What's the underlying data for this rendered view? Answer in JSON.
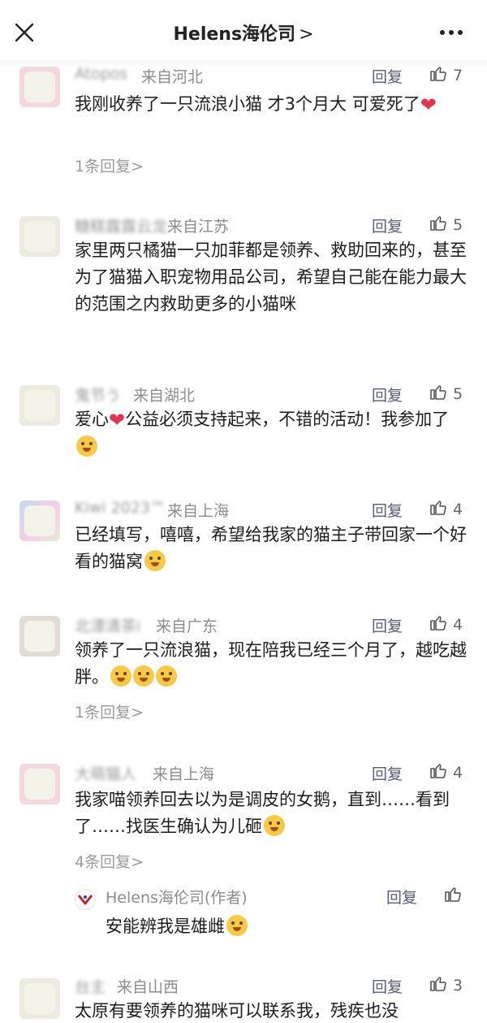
{
  "header": {
    "title": "Helens海伦司",
    "title_arrow": ">",
    "close_icon": "close-icon",
    "more_icon": "more-dots-icon"
  },
  "comments": [
    {
      "user": "Atopos",
      "location": "来自河北",
      "reply_label": "回复",
      "likes": "7",
      "text": "我刚收养了一只流浪小猫 才3个月大 可爱死了",
      "more_replies": "1条回复>"
    },
    {
      "user": "糖糕露露云龙",
      "location": "来自江苏",
      "reply_label": "回复",
      "likes": "5",
      "text": "家里两只橘猫一只加菲都是领养、救助回来的，甚至为了猫猫入职宠物用品公司，希望自己能在能力最大的范围之内救助更多的小猫咪"
    },
    {
      "user": "鬼节う",
      "location": "来自湖北",
      "reply_label": "回复",
      "likes": "5",
      "text_a": "爱心",
      "text_b": "公益必须支持起来，不错的活动！我参加了"
    },
    {
      "user": "Kiwi 2023™",
      "location": "来自上海",
      "reply_label": "回复",
      "likes": "4",
      "text": "已经填写，嘻嘻，希望给我家的猫主子带回家一个好看的猫窝"
    },
    {
      "user": "北漂清茶i",
      "location": "来自广东",
      "reply_label": "回复",
      "likes": "4",
      "text": "领养了一只流浪猫，现在陪我已经三个月了，越吃越胖。",
      "more_replies": "1条回复>"
    },
    {
      "user": "大萌猫人",
      "location": "来自上海",
      "reply_label": "回复",
      "likes": "4",
      "text": "我家喵领养回去以为是调皮的女鹅，直到……看到了……找医生确认为儿砸",
      "more_replies": "4条回复>",
      "author_reply": {
        "name": "Helens海伦司(作者)",
        "reply_label": "回复",
        "text": "安能辨我是雄雌"
      }
    },
    {
      "user": "台主",
      "location": "来自山西",
      "reply_label": "回复",
      "likes": "3",
      "text": "太原有要领养的猫咪可以联系我，残疾也没"
    }
  ]
}
